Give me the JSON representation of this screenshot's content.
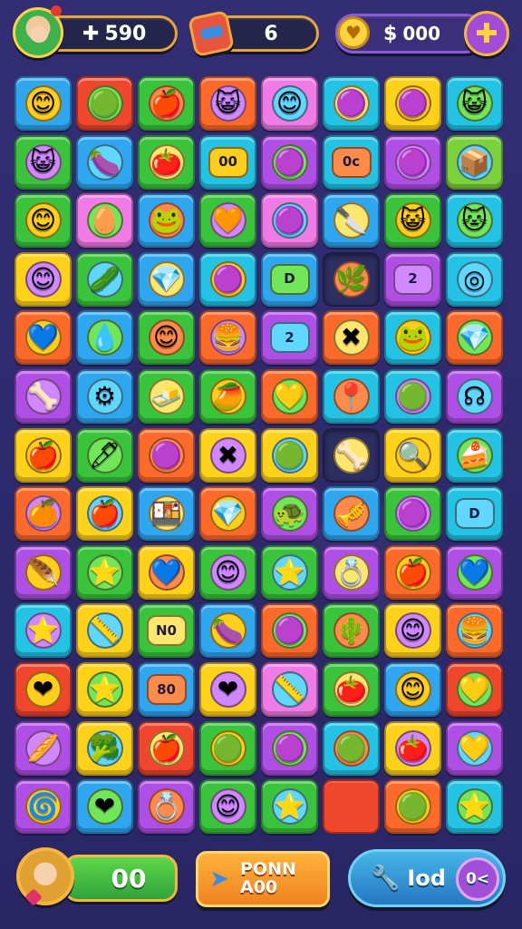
{
  "hud": {
    "coins": "590",
    "coins_glyph": "✚",
    "moves": "6",
    "cash": "000",
    "cash_glyph": "$",
    "heart_glyph": "♥",
    "plus_glyph": "✚",
    "avatar_icon": "player-avatar-green-hood",
    "moves_icon": "gift-box-icon"
  },
  "board": {
    "cols": 8,
    "rows": 13,
    "colors": {
      "orange": "#ff6a2a",
      "red": "#f0462c",
      "green": "#39c43b",
      "lime": "#7bd23a",
      "yellow": "#ffd21a",
      "blue": "#2fa6f0",
      "cyan": "#23c3e6",
      "purple": "#b04fe6",
      "pink": "#f07ae6",
      "magenta": "#d43fd6",
      "dark": "#2d2e62"
    },
    "tiles": [
      [
        "blue:😊",
        "red:🟢",
        "green:🍎",
        "orange:😺",
        "pink:😊",
        "cyan:🟣",
        "yellow:🟣",
        "cyan:😺"
      ],
      [
        "green:😺",
        "blue:🍆",
        "green:🍅",
        "cyan:00",
        "purple:🟣",
        "cyan:0c",
        "purple:🟣",
        "lime:📦"
      ],
      [
        "green:😊",
        "pink:🥚",
        "blue:🐸",
        "green:🧡",
        "pink:🟣",
        "blue:🔪",
        "green:😺",
        "cyan:🐱"
      ],
      [
        "yellow:😊",
        "green:🥒",
        "blue:💎",
        "cyan:🟣",
        "blue:D",
        "dark:🌿",
        "purple:2",
        "cyan:◎"
      ],
      [
        "orange:💙",
        "blue:💧",
        "green:😊",
        "orange:🍔",
        "purple:2",
        "orange:✖",
        "cyan:🐸",
        "orange:💎"
      ],
      [
        "purple:🦴",
        "blue:⚙",
        "green:🧈",
        "green:🥭",
        "orange:💛",
        "cyan:📍",
        "cyan:🟢",
        "purple:☊"
      ],
      [
        "yellow:🍎",
        "green:🖊",
        "orange:🟣",
        "yellow:✖",
        "yellow:🟢",
        "dark:🦴",
        "yellow:🔍",
        "cyan:🍰"
      ],
      [
        "orange:🍊",
        "yellow:🍎",
        "blue:🍱",
        "orange:💎",
        "purple:🐢",
        "blue:🎺",
        "green:🟣",
        "cyan:D"
      ],
      [
        "purple:🪶",
        "green:⭐",
        "yellow:💙",
        "green:😊",
        "green:⭐",
        "purple:💍",
        "orange:🍎",
        "purple:💙"
      ],
      [
        "cyan:⭐",
        "yellow:📏",
        "green:N0",
        "blue:🍆",
        "orange:🟣",
        "green:🌵",
        "yellow:😊",
        "orange:🍔"
      ],
      [
        "red:❤",
        "yellow:⭐",
        "blue:80",
        "yellow:❤",
        "pink:📏",
        "green:🍅",
        "blue:😊",
        "red:💛"
      ],
      [
        "purple:🥖",
        "yellow:🥦",
        "red:🍎",
        "green:🟢",
        "purple:🟣",
        "cyan:🟢",
        "yellow:🍅",
        "purple:💛"
      ],
      [
        "purple:🌀",
        "blue:❤",
        "purple:💍",
        "green:😊",
        "green:⭐",
        "red:",
        "orange:🟢",
        "cyan:⭐"
      ]
    ]
  },
  "bottom": {
    "score": "00",
    "mid_line1": "PONN",
    "mid_line2": "A00",
    "mid_icon": "paper-plane-icon",
    "right_label": "Iod",
    "right_tool_glyph": "🔧",
    "right_badge": "0<"
  }
}
